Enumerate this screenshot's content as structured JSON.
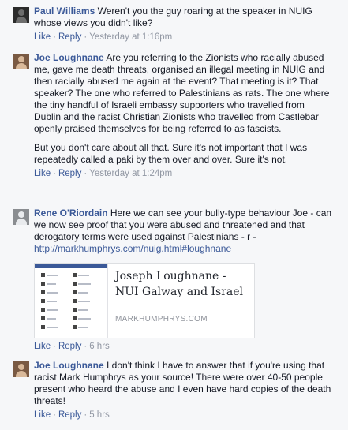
{
  "comments": [
    {
      "author": "Paul Williams",
      "text": "Weren't you the guy roaring at the speaker in NUIG whose views you didn't like?",
      "like": "Like",
      "reply": "Reply",
      "time": "Yesterday at 1:16pm"
    },
    {
      "author": "Joe Loughnane",
      "text": "Are you referring to the Zionists who racially abused me, gave me death threats, organised an illegal meeting in NUIG and then racially abused me again at the event? That meeting is it? That speaker? The one who referred to Palestinians as rats. The one where the tiny handful of Israeli embassy supporters who travelled from Dublin and the racist Christian Zionists who travelled from Castlebar openly praised themselves for being referred to as fascists.",
      "text2": "But you don't care about all that. Sure it's not important that I was repeatedly called a paki by them over and over. Sure it's not.",
      "like": "Like",
      "reply": "Reply",
      "time": "Yesterday at 1:24pm"
    },
    {
      "author": "Rene O'Riordain",
      "text": "Here we can see your bully-type behaviour Joe - can we now see proof that you were abused and threatened and that derogatory terms were used against Palestinians - r -",
      "link": "http://markhumphrys.com/nuig.html#loughnane",
      "preview_title": "Joseph Loughnane - NUI Galway and Israel",
      "preview_domain": "MARKHUMPHRYS.COM",
      "like": "Like",
      "reply": "Reply",
      "time": "6 hrs"
    },
    {
      "author": "Joe Loughnane",
      "text": "I don't think I have to answer that if you're using that racist Mark Humphrys as your source! There were over 40-50 people present who heard the abuse and I even have hard copies of the death threats!",
      "like": "Like",
      "reply": "Reply",
      "time": "5 hrs"
    }
  ]
}
